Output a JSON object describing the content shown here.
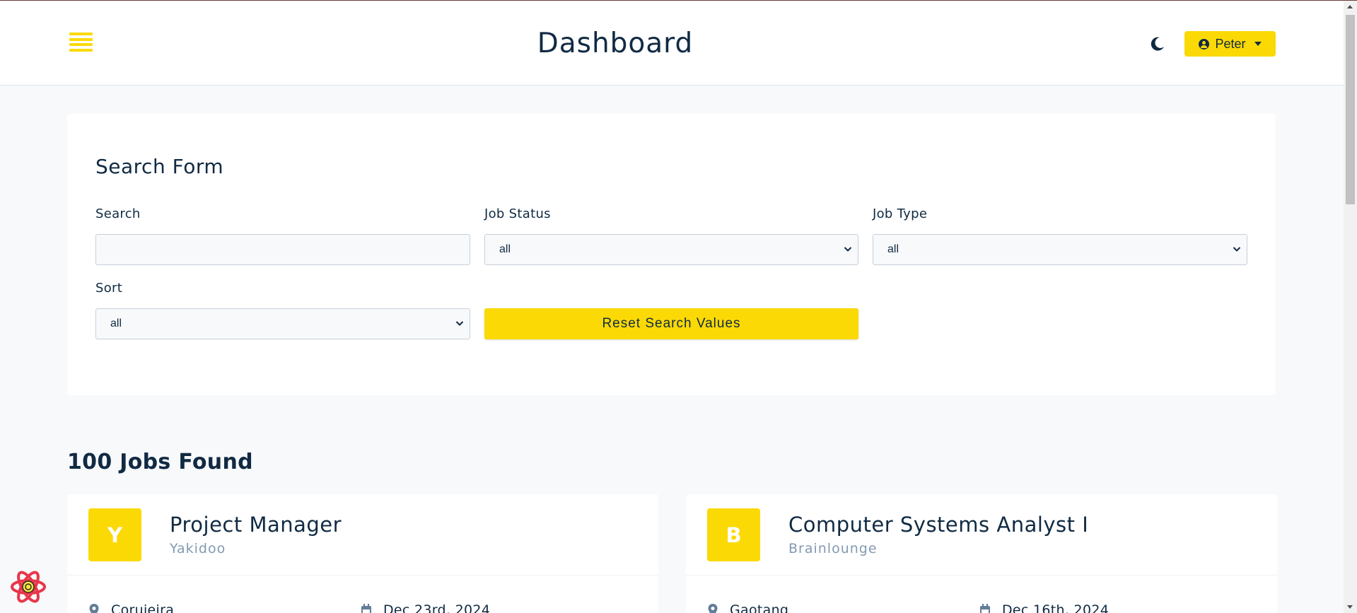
{
  "header": {
    "title": "Dashboard",
    "user_label": "Peter"
  },
  "search_form": {
    "title": "Search Form",
    "search": {
      "label": "Search",
      "value": "",
      "placeholder": ""
    },
    "job_status": {
      "label": "Job Status",
      "value": "all"
    },
    "job_type": {
      "label": "Job Type",
      "value": "all"
    },
    "sort": {
      "label": "Sort",
      "value": "all"
    },
    "reset_label": "Reset Search Values"
  },
  "jobs_found": "100 Jobs Found",
  "jobs": [
    {
      "avatar": "Y",
      "title": "Project Manager",
      "company": "Yakidoo",
      "location": "Coruieira",
      "date": "Dec 23rd, 2024"
    },
    {
      "avatar": "B",
      "title": "Computer Systems Analyst I",
      "company": "Brainlounge",
      "location": "Gaotang",
      "date": "Dec 16th, 2024"
    }
  ],
  "colors": {
    "accent": "#fbd905",
    "text": "#102a43",
    "muted": "#829ab1",
    "background": "#f8f9fb"
  },
  "icons": {
    "menu": "menu-icon",
    "theme": "moon-icon",
    "user": "user-circle-icon",
    "caret": "caret-down-icon",
    "location": "location-pin-icon",
    "date": "calendar-icon",
    "devtools": "react-logo-icon"
  }
}
